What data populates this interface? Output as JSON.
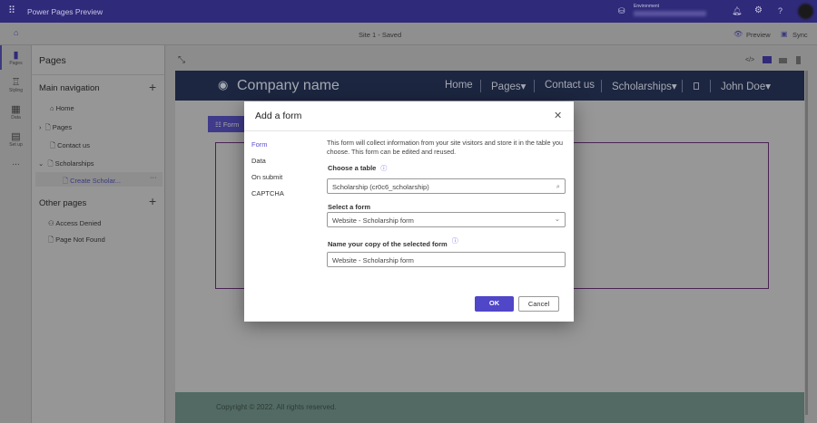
{
  "app": {
    "title": "Power Pages Preview",
    "environment_label": "Environment"
  },
  "cmdbar": {
    "site_status": "Site 1 - Saved",
    "preview": "Preview",
    "sync": "Sync"
  },
  "rail": [
    {
      "label": "Pages",
      "icon": "page-icon"
    },
    {
      "label": "Styling",
      "icon": "brush-icon"
    },
    {
      "label": "Data",
      "icon": "table-icon"
    },
    {
      "label": "Set up",
      "icon": "setup-icon"
    },
    {
      "label": "...",
      "icon": "more-icon"
    }
  ],
  "pages": {
    "title": "Pages",
    "main_nav": "Main navigation",
    "items": [
      "Home",
      "Pages",
      "Contact us",
      "Scholarships",
      "Create Scholar..."
    ],
    "other": "Other pages",
    "other_items": [
      "Access Denied",
      "Page Not Found"
    ]
  },
  "site": {
    "company": "Company name",
    "nav": [
      "Home",
      "Pages",
      "Contact us",
      "Scholarships",
      "John Doe"
    ],
    "form_button": "Form",
    "footer": "Copyright © 2022. All rights reserved."
  },
  "dialog": {
    "title": "Add a form",
    "tabs": [
      "Form",
      "Data",
      "On submit",
      "CAPTCHA"
    ],
    "description": "This form will collect information from your site visitors and store it in the table you choose. This form can be edited and reused.",
    "table_label": "Choose a table",
    "table_value": "Scholarship (cr0c6_scholarship)",
    "form_label": "Select a form",
    "form_value": "Website - Scholarship form",
    "name_label": "Name your copy of the selected form",
    "name_value": "Website - Scholarship form",
    "ok": "OK",
    "cancel": "Cancel"
  },
  "colors": {
    "accent": "#4f46c8",
    "topbar": "#2f2a79"
  }
}
